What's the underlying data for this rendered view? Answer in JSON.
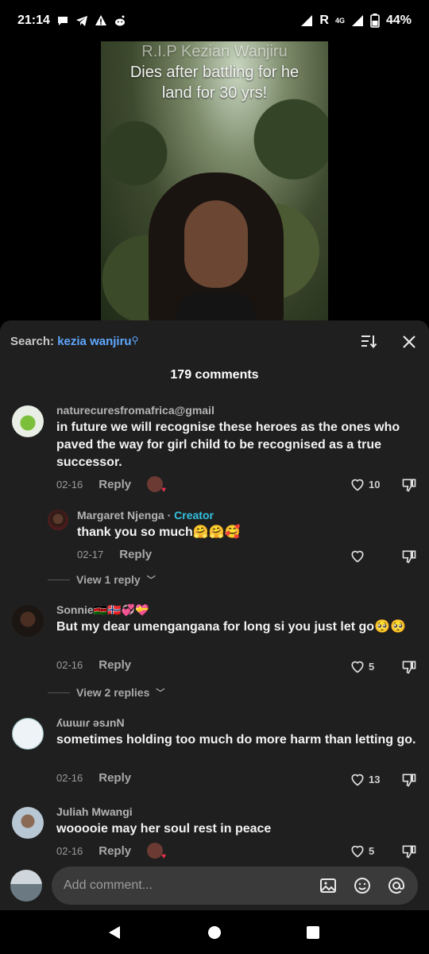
{
  "status_bar": {
    "time": "21:14",
    "left_icons": [
      "chat-bubble-icon",
      "telegram-icon",
      "warning-icon",
      "reddit-icon"
    ],
    "network_label": "R",
    "network_type": "4G",
    "battery": "44%"
  },
  "video": {
    "caption_line1": "R.I.P Kezian Wanjiru",
    "caption_line2": "Dies after battling for he",
    "caption_line3": "land for 30 yrs!"
  },
  "sheet": {
    "search_prefix": "Search:",
    "search_query": "kezia wanjiru",
    "comment_count": "179 comments"
  },
  "comments": [
    {
      "user": "naturecuresfromafrica@gmail",
      "text": "in future we will recognise these heroes as the ones who paved the way for girl child to be recognised as a true successor.",
      "date": "02-16",
      "reply_label": "Reply",
      "likes": "10"
    },
    {
      "user": "Margaret Njenga",
      "creator_sep": " · ",
      "creator_label": "Creator",
      "text": "thank you so much🤗🤗🥰",
      "date": "02-17",
      "reply_label": "Reply",
      "likes": ""
    },
    {
      "view_replies": "View 1 reply"
    },
    {
      "user": "Sonnie🇰🇪🇳🇴💞💝",
      "text": "But my dear umengangana for long si you just let go🥺🥺",
      "date": "02-16",
      "reply_label": "Reply",
      "likes": "5"
    },
    {
      "view_replies": "View 2 replies"
    },
    {
      "user": "ʎɯɯıɾ ǝsɹnN",
      "text": "sometimes holding too much do more harm than letting go.",
      "date": "02-16",
      "reply_label": "Reply",
      "likes": "13"
    },
    {
      "user": "Juliah Mwangi",
      "text": "wooooie may her soul rest in peace",
      "date": "02-16",
      "reply_label": "Reply",
      "likes": "5"
    }
  ],
  "input": {
    "placeholder": "Add comment..."
  },
  "colors": {
    "sheet_bg": "#1f1f1f",
    "search_query": "#5fa8ff",
    "creator": "#34c2e0",
    "input_bg": "#3a3a3a"
  }
}
